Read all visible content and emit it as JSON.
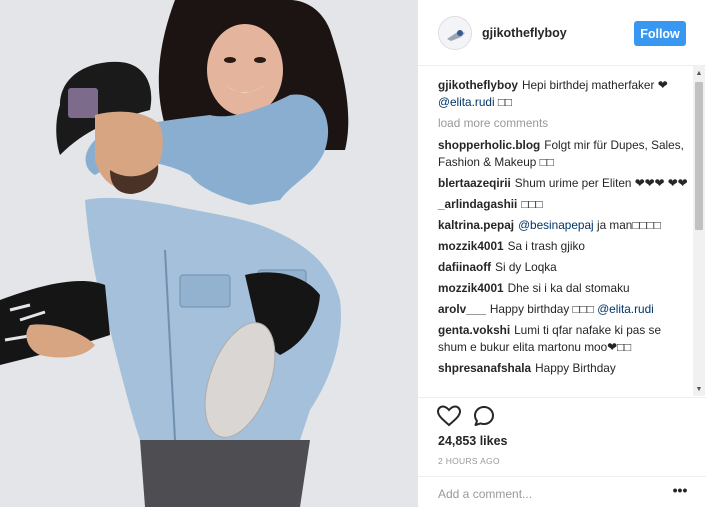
{
  "post": {
    "username": "gjikotheflyboy",
    "follow_label": "Follow",
    "comments": [
      {
        "user": "gjikotheflyboy",
        "text": "Hepi birthdej matherfaker ❤",
        "mention": "@elita.rudi",
        "tail": " □□"
      },
      {
        "user": "shopperholic.blog",
        "text": "Folgt mir für Dupes, Sales, Fashion & Makeup □□",
        "mention": "",
        "tail": ""
      },
      {
        "user": "blertaazeqirii",
        "text": "Shum urime per Eliten ❤❤❤ ❤❤",
        "mention": "",
        "tail": ""
      },
      {
        "user": "_arlindagashii",
        "text": "□□□",
        "mention": "",
        "tail": ""
      },
      {
        "user": "kaltrina.pepaj",
        "text": "",
        "mention": "@besinapepaj",
        "tail": " ja man□□□□"
      },
      {
        "user": "mozzik4001",
        "text": "Sa i trash gjiko",
        "mention": "",
        "tail": ""
      },
      {
        "user": "dafiinaoff",
        "text": "Si dy Loqka",
        "mention": "",
        "tail": ""
      },
      {
        "user": "mozzik4001",
        "text": "Dhe si i ka dal stomaku",
        "mention": "",
        "tail": ""
      },
      {
        "user": "arolv___",
        "text": "Happy birthday □□□",
        "mention": "@elita.rudi",
        "tail": ""
      },
      {
        "user": "genta.vokshi",
        "text": "Lumi ti qfar nafake ki pas se shum e bukur elita martonu moo❤□□",
        "mention": "",
        "tail": ""
      },
      {
        "user": "shpresanafshala",
        "text": "Happy Birthday",
        "mention": "",
        "tail": ""
      }
    ],
    "load_more": "load more comments",
    "likes": "24,853 likes",
    "time": "2 HOURS AGO",
    "add_comment_placeholder": "Add a comment...",
    "more_label": "•••"
  },
  "colors": {
    "follow_bg": "#3897f0",
    "mention": "#003569",
    "muted": "#999999"
  },
  "icons": {
    "like": "heart-outline-icon",
    "comment": "speech-bubble-icon",
    "scroll_up": "triangle-up-icon",
    "scroll_down": "triangle-down-icon"
  }
}
